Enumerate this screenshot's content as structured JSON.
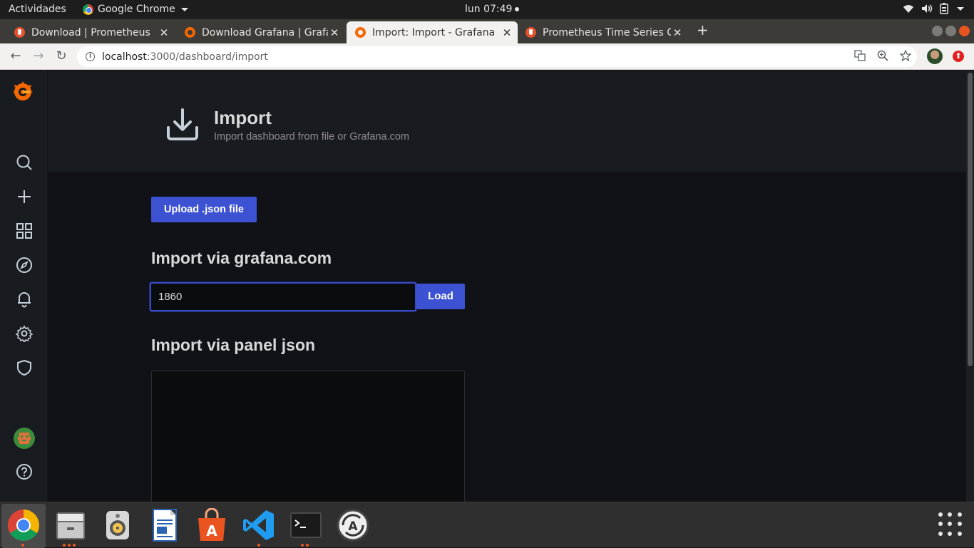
{
  "system_bar": {
    "activities": "Actividades",
    "app_name": "Google Chrome",
    "clock": "lun 07:49"
  },
  "browser": {
    "tabs": [
      {
        "title": "Download | Prometheus",
        "favicon": "prometheus-icon",
        "active": false
      },
      {
        "title": "Download Grafana | Grafana",
        "favicon": "grafana-icon",
        "active": false
      },
      {
        "title": "Import: Import - Grafana",
        "favicon": "grafana-icon",
        "active": true
      },
      {
        "title": "Prometheus Time Series Collection",
        "favicon": "prometheus-icon",
        "active": false
      }
    ],
    "url_host": "localhost",
    "url_path": ":3000/dashboard/import"
  },
  "grafana": {
    "sidebar": {
      "items": [
        "search-icon",
        "plus-icon",
        "dashboards-icon",
        "explore-icon",
        "alerting-icon",
        "configuration-icon",
        "server-admin-icon",
        "user-avatar",
        "help-icon"
      ]
    },
    "header": {
      "title": "Import",
      "subtitle": "Import dashboard from file or Grafana.com"
    },
    "upload_button": "Upload .json file",
    "grafana_com": {
      "heading": "Import via grafana.com",
      "input_value": "1860",
      "load_button": "Load"
    },
    "panel_json": {
      "heading": "Import via panel json",
      "value": ""
    }
  },
  "dock": {
    "apps": [
      "chrome-icon",
      "files-icon",
      "rhythmbox-icon",
      "libreoffice-writer-icon",
      "software-center-icon",
      "vscode-icon",
      "terminal-icon",
      "software-updater-icon"
    ]
  },
  "colors": {
    "accent": "#3d52d3",
    "sidebar_bg": "#181b1f",
    "page_bg": "#111217",
    "grafana_orange": "#f46800",
    "ubuntu_orange": "#e95420"
  }
}
